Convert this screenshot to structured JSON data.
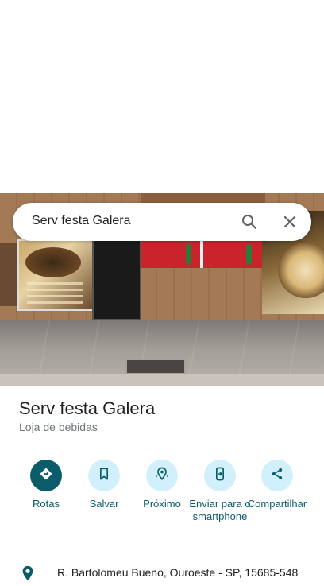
{
  "search": {
    "query": "Serv festa Galera"
  },
  "place": {
    "name": "Serv festa Galera",
    "category": "Loja de bebidas"
  },
  "actions": [
    {
      "label": "Rotas",
      "icon": "directions-icon"
    },
    {
      "label": "Salvar",
      "icon": "bookmark-icon"
    },
    {
      "label": "Próximo",
      "icon": "nearby-icon"
    },
    {
      "label": "Enviar para o smartphone",
      "icon": "send-to-phone-icon"
    },
    {
      "label": "Compartilhar",
      "icon": "share-icon"
    }
  ],
  "address": {
    "text": "R. Bartolomeu Bueno, Ouroeste - SP, 15685-548"
  },
  "colors": {
    "accent": "#0b5c6b",
    "chip_bg": "#d2f0fb",
    "title": "#202124",
    "subtle": "#70757a"
  }
}
